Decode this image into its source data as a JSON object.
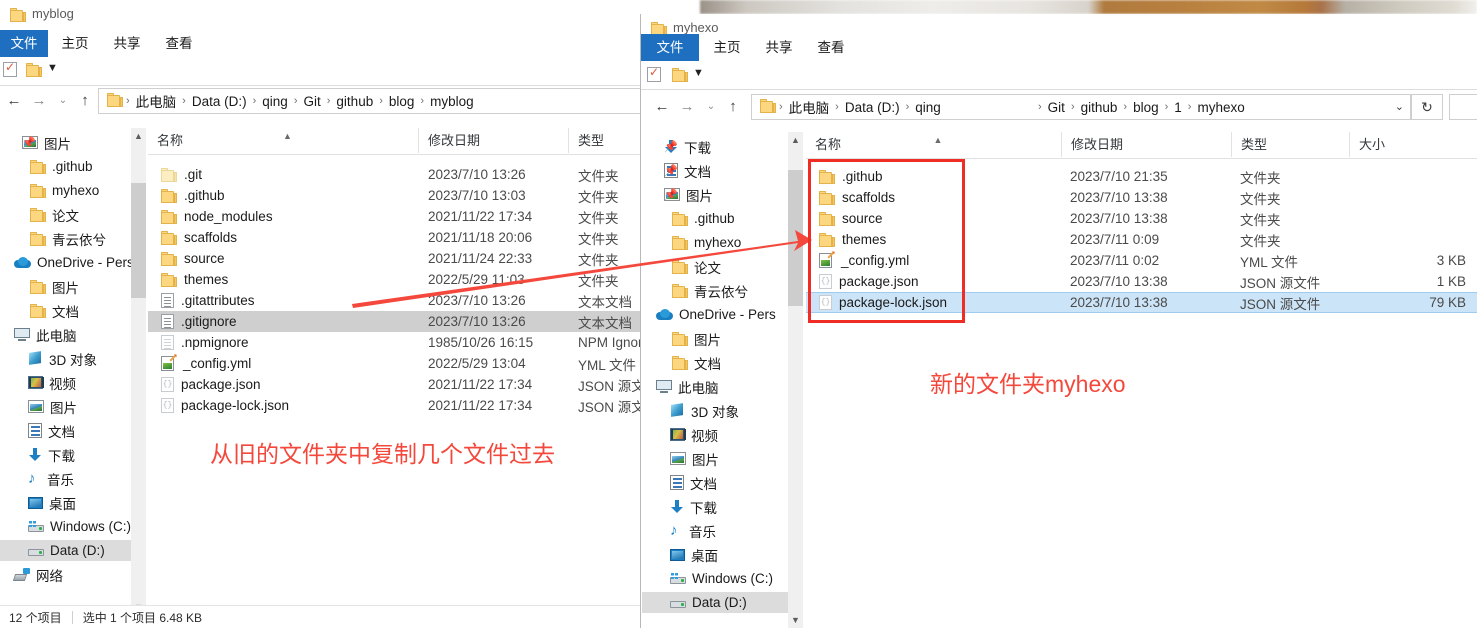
{
  "left_window": {
    "title": "myblog",
    "title_icon": "folder-icon",
    "ribbon_tabs": [
      {
        "label": "文件",
        "active": true
      },
      {
        "label": "主页",
        "active": false
      },
      {
        "label": "共享",
        "active": false
      },
      {
        "label": "查看",
        "active": false
      }
    ],
    "quick_access_toolbar": {
      "properties_icon": "properties-checklist-icon",
      "new_folder_icon": "new-folder-icon",
      "customize_icon": "chevron-down-icon"
    },
    "nav_buttons": {
      "back": "←",
      "forward": "→",
      "recent": "⌄",
      "up": "↑"
    },
    "breadcrumb": [
      "此电脑",
      "Data (D:)",
      "qing",
      "Git",
      "github",
      "blog",
      "myblog"
    ],
    "nav_pane": [
      {
        "label": "图片",
        "icon": "pictures-icon",
        "indent": 22,
        "pinned": true
      },
      {
        "label": ".github",
        "icon": "folder-icon",
        "indent": 30,
        "pinned": false
      },
      {
        "label": "myhexo",
        "icon": "folder-icon",
        "indent": 30,
        "pinned": false
      },
      {
        "label": "论文",
        "icon": "folder-icon",
        "indent": 30,
        "pinned": false
      },
      {
        "label": "青云依兮",
        "icon": "folder-icon",
        "indent": 30,
        "pinned": false
      },
      {
        "label": "OneDrive - Pers",
        "icon": "onedrive-cloud-icon",
        "indent": 14,
        "pinned": false
      },
      {
        "label": "图片",
        "icon": "folder-icon",
        "indent": 30,
        "pinned": false
      },
      {
        "label": "文档",
        "icon": "folder-icon",
        "indent": 30,
        "pinned": false
      },
      {
        "label": "此电脑",
        "icon": "this-pc-icon",
        "indent": 14,
        "pinned": false
      },
      {
        "label": "3D 对象",
        "icon": "3d-objects-icon",
        "indent": 28,
        "pinned": false
      },
      {
        "label": "视频",
        "icon": "videos-icon",
        "indent": 28,
        "pinned": false
      },
      {
        "label": "图片",
        "icon": "pictures-icon",
        "indent": 28,
        "pinned": false
      },
      {
        "label": "文档",
        "icon": "documents-icon",
        "indent": 28,
        "pinned": false
      },
      {
        "label": "下载",
        "icon": "downloads-icon",
        "indent": 28,
        "pinned": false
      },
      {
        "label": "音乐",
        "icon": "music-icon",
        "indent": 28,
        "pinned": false
      },
      {
        "label": "桌面",
        "icon": "desktop-icon",
        "indent": 28,
        "pinned": false
      },
      {
        "label": "Windows (C:)",
        "icon": "windows-drive-icon",
        "indent": 28,
        "pinned": false
      },
      {
        "label": "Data (D:)",
        "icon": "drive-icon",
        "indent": 28,
        "pinned": false,
        "selected": true
      },
      {
        "label": "网络",
        "icon": "network-icon",
        "indent": 14,
        "pinned": false
      }
    ],
    "columns": [
      {
        "label": "名称",
        "sorted": true
      },
      {
        "label": "修改日期",
        "sorted": false
      },
      {
        "label": "类型",
        "sorted": false
      }
    ],
    "files": [
      {
        "name": ".git",
        "icon": "folder-pale-icon",
        "date": "2023/7/10 13:26",
        "type": "文件夹",
        "selected": false
      },
      {
        "name": ".github",
        "icon": "folder-icon",
        "date": "2023/7/10 13:03",
        "type": "文件夹",
        "selected": false
      },
      {
        "name": "node_modules",
        "icon": "folder-icon",
        "date": "2021/11/22 17:34",
        "type": "文件夹",
        "selected": false
      },
      {
        "name": "scaffolds",
        "icon": "folder-icon",
        "date": "2021/11/18 20:06",
        "type": "文件夹",
        "selected": false
      },
      {
        "name": "source",
        "icon": "folder-icon",
        "date": "2021/11/24 22:33",
        "type": "文件夹",
        "selected": false
      },
      {
        "name": "themes",
        "icon": "folder-icon",
        "date": "2022/5/29 11:03",
        "type": "文件夹",
        "selected": false
      },
      {
        "name": ".gitattributes",
        "icon": "text-file-icon",
        "date": "2023/7/10 13:26",
        "type": "文本文档",
        "selected": false
      },
      {
        "name": ".gitignore",
        "icon": "text-file-icon",
        "date": "2023/7/10 13:26",
        "type": "文本文档",
        "selected": true
      },
      {
        "name": ".npmignore",
        "icon": "text-file-faint-icon",
        "date": "1985/10/26 16:15",
        "type": "NPM Ignore",
        "selected": false
      },
      {
        "name": "_config.yml",
        "icon": "yml-file-icon",
        "date": "2022/5/29 13:04",
        "type": "YML 文件",
        "selected": false
      },
      {
        "name": "package.json",
        "icon": "json-file-icon",
        "date": "2021/11/22 17:34",
        "type": "JSON 源文件",
        "selected": false
      },
      {
        "name": "package-lock.json",
        "icon": "json-file-icon",
        "date": "2021/11/22 17:34",
        "type": "JSON 源文件",
        "selected": false
      }
    ],
    "status": {
      "count": "12 个项目",
      "selection": "选中 1 个项目  6.48 KB"
    }
  },
  "right_window": {
    "title": "myhexo",
    "title_icon": "folder-icon",
    "ribbon_tabs": [
      {
        "label": "文件",
        "active": true
      },
      {
        "label": "主页",
        "active": false
      },
      {
        "label": "共享",
        "active": false
      },
      {
        "label": "查看",
        "active": false
      }
    ],
    "quick_access_toolbar": {
      "properties_icon": "properties-checklist-icon",
      "new_folder_icon": "new-folder-icon",
      "customize_icon": "chevron-down-icon"
    },
    "nav_buttons": {
      "back": "←",
      "forward": "→",
      "recent": "⌄",
      "up": "↑",
      "dropdown": "⌄",
      "refresh": "↻"
    },
    "breadcrumb": [
      "此电脑",
      "Data (D:)",
      "qing",
      "Git",
      "github",
      "blog",
      "1",
      "myhexo"
    ],
    "nav_pane": [
      {
        "label": "下载",
        "icon": "downloads-icon",
        "indent": 22,
        "pinned": true
      },
      {
        "label": "文档",
        "icon": "documents-icon",
        "indent": 22,
        "pinned": true
      },
      {
        "label": "图片",
        "icon": "pictures-icon",
        "indent": 22,
        "pinned": true
      },
      {
        "label": ".github",
        "icon": "folder-icon",
        "indent": 30,
        "pinned": false
      },
      {
        "label": "myhexo",
        "icon": "folder-icon",
        "indent": 30,
        "pinned": false
      },
      {
        "label": "论文",
        "icon": "folder-icon",
        "indent": 30,
        "pinned": false
      },
      {
        "label": "青云依兮",
        "icon": "folder-icon",
        "indent": 30,
        "pinned": false
      },
      {
        "label": "OneDrive - Pers",
        "icon": "onedrive-cloud-icon",
        "indent": 14,
        "pinned": false
      },
      {
        "label": "图片",
        "icon": "folder-icon",
        "indent": 30,
        "pinned": false
      },
      {
        "label": "文档",
        "icon": "folder-icon",
        "indent": 30,
        "pinned": false
      },
      {
        "label": "此电脑",
        "icon": "this-pc-icon",
        "indent": 14,
        "pinned": false
      },
      {
        "label": "3D 对象",
        "icon": "3d-objects-icon",
        "indent": 28,
        "pinned": false
      },
      {
        "label": "视频",
        "icon": "videos-icon",
        "indent": 28,
        "pinned": false
      },
      {
        "label": "图片",
        "icon": "pictures-icon",
        "indent": 28,
        "pinned": false
      },
      {
        "label": "文档",
        "icon": "documents-icon",
        "indent": 28,
        "pinned": false
      },
      {
        "label": "下载",
        "icon": "downloads-icon",
        "indent": 28,
        "pinned": false
      },
      {
        "label": "音乐",
        "icon": "music-icon",
        "indent": 28,
        "pinned": false
      },
      {
        "label": "桌面",
        "icon": "desktop-icon",
        "indent": 28,
        "pinned": false
      },
      {
        "label": "Windows (C:)",
        "icon": "windows-drive-icon",
        "indent": 28,
        "pinned": false
      },
      {
        "label": "Data (D:)",
        "icon": "drive-icon",
        "indent": 28,
        "pinned": false,
        "selected": true
      }
    ],
    "columns": [
      {
        "label": "名称",
        "sorted": true
      },
      {
        "label": "修改日期",
        "sorted": false
      },
      {
        "label": "类型",
        "sorted": false
      },
      {
        "label": "大小",
        "sorted": false
      }
    ],
    "files": [
      {
        "name": ".github",
        "icon": "folder-icon",
        "date": "2023/7/10 21:35",
        "type": "文件夹",
        "size": "",
        "selected": false
      },
      {
        "name": "scaffolds",
        "icon": "folder-icon",
        "date": "2023/7/10 13:38",
        "type": "文件夹",
        "size": "",
        "selected": false
      },
      {
        "name": "source",
        "icon": "folder-icon",
        "date": "2023/7/10 13:38",
        "type": "文件夹",
        "size": "",
        "selected": false
      },
      {
        "name": "themes",
        "icon": "folder-icon",
        "date": "2023/7/11 0:09",
        "type": "文件夹",
        "size": "",
        "selected": false
      },
      {
        "name": "_config.yml",
        "icon": "yml-file-icon",
        "date": "2023/7/11 0:02",
        "type": "YML 文件",
        "size": "3 KB",
        "selected": false
      },
      {
        "name": "package.json",
        "icon": "json-file-icon",
        "date": "2023/7/10 13:38",
        "type": "JSON 源文件",
        "size": "1 KB",
        "selected": false
      },
      {
        "name": "package-lock.json",
        "icon": "json-file-icon",
        "date": "2023/7/10 13:38",
        "type": "JSON 源文件",
        "size": "79 KB",
        "selected": true
      }
    ]
  },
  "annotations": {
    "left_note": "从旧的文件夹中复制几个文件过去",
    "right_note": "新的文件夹myhexo",
    "arrow": "copy-arrow",
    "accent_color": "#f4483c",
    "box_color": "#ef2d24",
    "highlight_color": "#cce4f7"
  }
}
